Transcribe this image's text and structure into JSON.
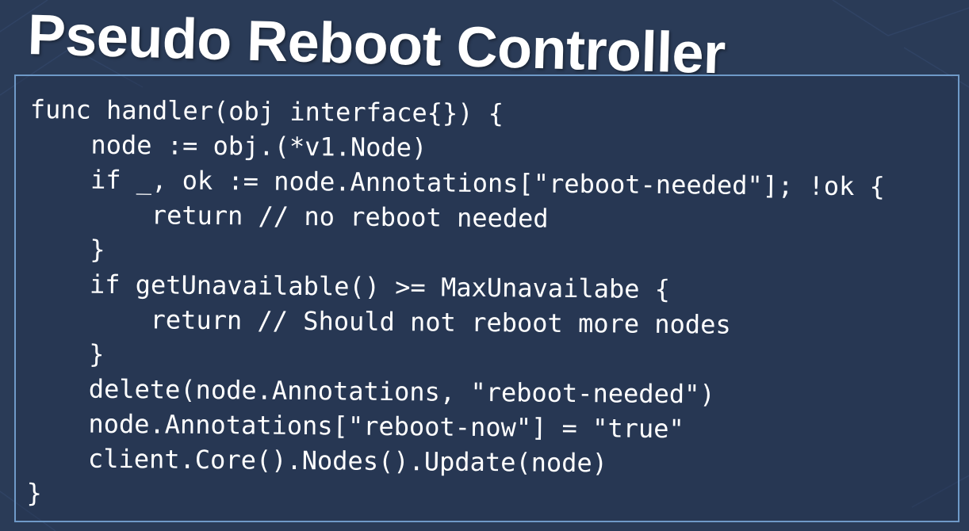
{
  "slide": {
    "title": "Pseudo Reboot Controller"
  },
  "code": {
    "lines": [
      "func handler(obj interface{}) {",
      "    node := obj.(*v1.Node)",
      "    if _, ok := node.Annotations[\"reboot-needed\"]; !ok {",
      "        return // no reboot needed",
      "    }",
      "    if getUnavailable() >= MaxUnavailabe {",
      "        return // Should not reboot more nodes",
      "    }",
      "    delete(node.Annotations, \"reboot-needed\")",
      "    node.Annotations[\"reboot-now\"] = \"true\"",
      "    client.Core().Nodes().Update(node)",
      "}"
    ]
  },
  "colors": {
    "background": "#2a3b57",
    "border": "#6f9ac8",
    "text": "#ffffff"
  }
}
